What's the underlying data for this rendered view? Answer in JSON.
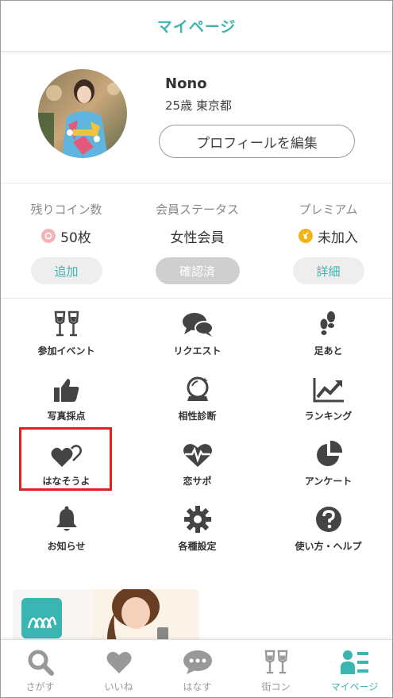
{
  "header": {
    "title": "マイページ"
  },
  "profile": {
    "name": "Nono",
    "age_location": "25歳 東京都",
    "edit_label": "プロフィールを編集"
  },
  "stats": {
    "coins": {
      "label": "残りコイン数",
      "value": "50枚",
      "button": "追加"
    },
    "status": {
      "label": "会員ステータス",
      "value": "女性会員",
      "button": "確認済"
    },
    "premium": {
      "label": "プレミアム",
      "value": "未加入",
      "button": "詳細"
    }
  },
  "menu": [
    {
      "label": "参加イベント",
      "icon": "champagne-glasses-icon"
    },
    {
      "label": "リクエスト",
      "icon": "chat-bubbles-icon"
    },
    {
      "label": "足あと",
      "icon": "footprints-icon"
    },
    {
      "label": "写真採点",
      "icon": "thumbs-up-icon"
    },
    {
      "label": "相性診断",
      "icon": "crystal-ball-icon"
    },
    {
      "label": "ランキング",
      "icon": "line-chart-icon"
    },
    {
      "label": "はなそうよ",
      "icon": "hearts-icon"
    },
    {
      "label": "恋サポ",
      "icon": "heartbeat-icon"
    },
    {
      "label": "アンケート",
      "icon": "pie-chart-icon"
    },
    {
      "label": "お知らせ",
      "icon": "bell-icon"
    },
    {
      "label": "各種設定",
      "icon": "gear-icon"
    },
    {
      "label": "使い方・ヘルプ",
      "icon": "question-icon"
    }
  ],
  "tabs": [
    {
      "label": "さがす",
      "icon": "search-icon"
    },
    {
      "label": "いいね",
      "icon": "heart-icon"
    },
    {
      "label": "はなす",
      "icon": "chat-icon"
    },
    {
      "label": "街コン",
      "icon": "champagne-glasses-icon"
    },
    {
      "label": "マイページ",
      "icon": "profile-list-icon"
    }
  ],
  "colors": {
    "accent": "#3bb5b2",
    "icon": "#444444",
    "highlight": "#e02020"
  }
}
